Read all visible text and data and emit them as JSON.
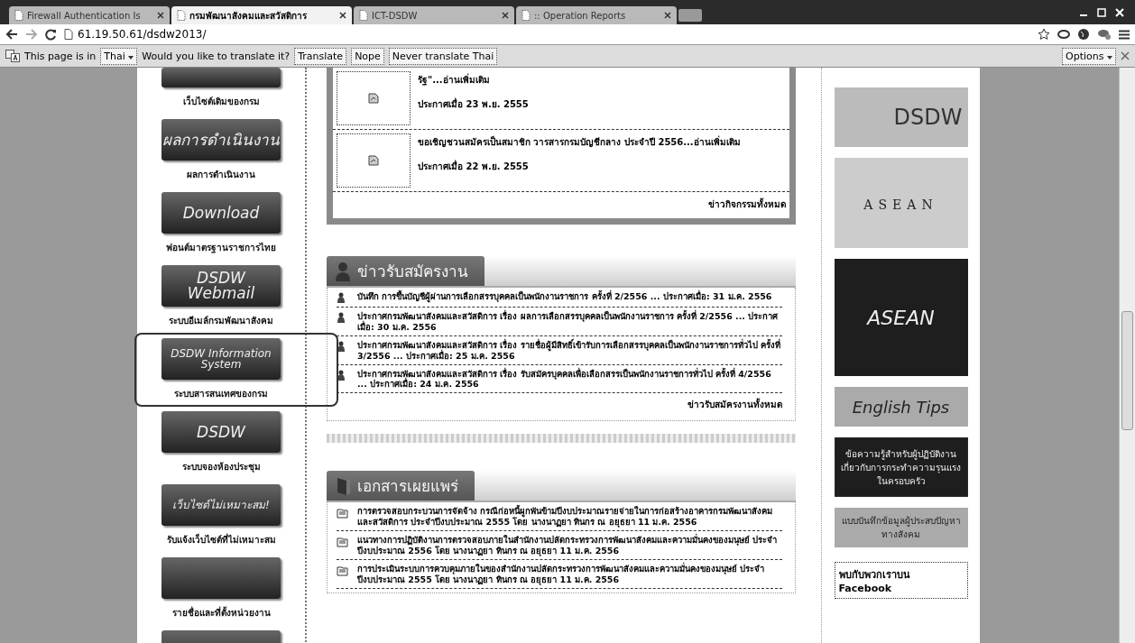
{
  "browser": {
    "tabs": [
      {
        "title": "Firewall Authentication Is",
        "selected": false
      },
      {
        "title": "กรมพัฒนาสังคมและสวัสดิการ",
        "selected": true
      },
      {
        "title": "ICT-DSDW",
        "selected": false
      },
      {
        "title": ":: Operation Reports",
        "selected": false
      }
    ],
    "url": "61.19.50.61/dsdw2013/"
  },
  "translate_bar": {
    "prefix": "This page is in",
    "language": "Thai",
    "question": "Would you like to translate it?",
    "buttons": [
      "Translate",
      "Nope",
      "Never translate Thai"
    ],
    "options": "Options"
  },
  "sidebar": {
    "items": [
      {
        "caption": "เว็บไซต์เดิมของกรม",
        "highlighted": false
      },
      {
        "banner": "ผลการดำเนินงาน",
        "caption": "ผลการดำเนินงาน",
        "highlighted": false
      },
      {
        "banner": "Download",
        "caption": "ฟอนต์มาตรฐานราชการไทย",
        "highlighted": false
      },
      {
        "banner": "DSDW Webmail",
        "caption": "ระบบอีเมล์กรมพัฒนาสังคม",
        "highlighted": false
      },
      {
        "banner": "DSDW Information System",
        "caption": "ระบบสารสนเทศของกรม",
        "highlighted": true
      },
      {
        "banner": "DSDW",
        "caption": "ระบบจองห้องประชุม",
        "highlighted": false
      },
      {
        "banner": "เว็บไซต์ไม่เหมาะสม!",
        "caption": "รับแจ้งเว็บไซต์ที่ไม่เหมาะสม",
        "highlighted": false
      },
      {
        "caption": "รายชื่อและที่ตั้งหน่วยงาน",
        "highlighted": false
      },
      {
        "highlighted": false
      }
    ]
  },
  "activity_news": {
    "items": [
      {
        "title": "รัฐ\"...อ่านเพิ่มเติม",
        "date": "ประกาศเมื่อ 23 พ.ย. 2555"
      },
      {
        "title": "ขอเชิญชวนสมัครเป็นสมาชิก วารสารกรมบัญชีกลาง ประจำปี 2556...อ่านเพิ่มเติม",
        "date": "ประกาศเมื่อ 22 พ.ย. 2555"
      }
    ],
    "more_link": "ข่าวกิจกรรมทั้งหมด"
  },
  "sections": [
    {
      "kind": "jobs",
      "heading": "ข่าวรับสมัครงาน",
      "items": [
        "บันทึก การขึ้นบัญชีผู้ผ่านการเลือกสรรบุคคลเป็นพนักงานราชการ ครั้งที่ 2/2556 ... ประกาศเมื่อ: 31 ม.ค. 2556",
        "ประกาศกรมพัฒนาสังคมและสวัสดิการ เรื่อง ผลการเลือกสรรบุคคลเป็นพนักงานราชการ ครั้งที่ 2/2556 ... ประกาศเมื่อ: 30 ม.ค. 2556",
        "ประกาศกรมพัฒนาสังคมและสวัสดิการ เรื่อง รายชื่อผู้มีสิทธิ์เข้ารับการเลือกสรรบุคคลเป็นพนักงานราชการทั่วไป ครั้งที่ 3/2556 ... ประกาศเมื่อ: 25 ม.ค. 2556",
        "ประกาศกรมพัฒนาสังคมและสวัสดิการ เรื่อง รับสมัครบุคคลเพื่อเลือกสรรเป็นพนักงานราชการทั่วไป ครั้งที่ 4/2556 ... ประกาศเมื่อ: 24 ม.ค. 2556"
      ],
      "more_link": "ข่าวรับสมัครงานทั้งหมด"
    },
    {
      "kind": "documents",
      "heading": "เอกสารเผยแพร่",
      "items": [
        "การตรวจสอบกระบวนการจัดจ้าง กรณีก่อหนี้ผูกพันข้ามปีงบประมาณรายจ่ายในการก่อสร้างอาคารกรมพัฒนาสังคมและสวัสดิการ ประจำปีงบประมาณ 2555 โดย นางนาฏยา ทินกร ณ อยุธยา 11 ม.ค. 2556",
        "แนวทางการปฏิบัติงานการตรวจสอบภายในสำนักงานปลัดกระทรวงการพัฒนาสังคมและความมั่นคงของมนุษย์ ประจำปีงบประมาณ 2556 โดย นางนาฏยา ทินกร ณ อยุธยา 11 ม.ค. 2556",
        "การประเมินระบบการควบคุมภายในของสำนักงานปลัดกระทรวงการพัฒนาสังคมและความมั่นคงของมนุษย์ ประจำปีงบประมาณ 2555 โดย นางนาฏยา ทินกร ณ อยุธยา 11 ม.ค. 2556"
      ]
    }
  ],
  "right_column": {
    "banners": [
      {
        "kind": "logo",
        "text": "DSDW"
      },
      {
        "kind": "people",
        "text": "ASEAN"
      },
      {
        "kind": "dark",
        "text": "ASEAN"
      },
      {
        "kind": "light",
        "text": "English Tips"
      },
      {
        "kind": "dark",
        "text": "ข้อความรู้สำหรับผู้ปฏิบัติงานเกี่ยวกับการกระทำความรุนแรงในครอบครัว"
      },
      {
        "kind": "light",
        "text": "แบบบันทึกข้อมูลผู้ประสบปัญหาทางสังคม"
      }
    ],
    "facebook": "พบกับพวกเราบน Facebook"
  }
}
